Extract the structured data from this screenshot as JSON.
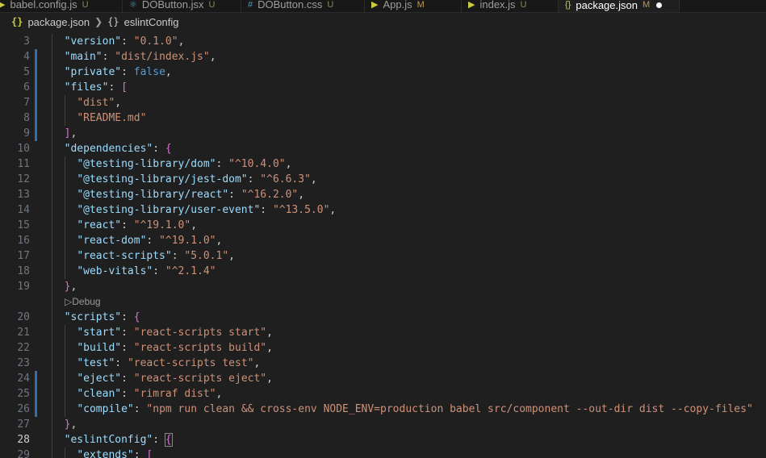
{
  "tabs": [
    {
      "label": "babel.config.js",
      "status": "U",
      "icon": "js-file-icon",
      "active": false
    },
    {
      "label": "DOButton.jsx",
      "status": "U",
      "icon": "react-file-icon",
      "active": false
    },
    {
      "label": "DOButton.css",
      "status": "U",
      "icon": "css-file-icon",
      "active": false
    },
    {
      "label": "App.js",
      "status": "M",
      "icon": "js-file-icon",
      "active": false
    },
    {
      "label": "index.js",
      "status": "U",
      "icon": "js-file-icon",
      "active": false
    },
    {
      "label": "package.json",
      "status": "M",
      "icon": "json-file-icon",
      "active": true
    }
  ],
  "breadcrumb": {
    "file_icon": "{}",
    "file": "package.json",
    "object_icon": "{}",
    "symbol": "eslintConfig"
  },
  "codelens": "Debug",
  "lines": [
    {
      "num": "3",
      "tokens": [
        [
          "p",
          "  "
        ],
        [
          "k",
          "\"version\""
        ],
        [
          "p",
          ": "
        ],
        [
          "s",
          "\"0.1.0\""
        ],
        [
          "p",
          ","
        ]
      ]
    },
    {
      "num": "4",
      "tokens": [
        [
          "p",
          "  "
        ],
        [
          "k",
          "\"main\""
        ],
        [
          "p",
          ": "
        ],
        [
          "s",
          "\"dist/index.js\""
        ],
        [
          "p",
          ","
        ]
      ]
    },
    {
      "num": "5",
      "tokens": [
        [
          "p",
          "  "
        ],
        [
          "k",
          "\"private\""
        ],
        [
          "p",
          ": "
        ],
        [
          "b",
          "false"
        ],
        [
          "p",
          ","
        ]
      ]
    },
    {
      "num": "6",
      "tokens": [
        [
          "p",
          "  "
        ],
        [
          "k",
          "\"files\""
        ],
        [
          "p",
          ": "
        ],
        [
          "br1",
          "["
        ]
      ]
    },
    {
      "num": "7",
      "tokens": [
        [
          "p",
          "    "
        ],
        [
          "s",
          "\"dist\""
        ],
        [
          "p",
          ","
        ]
      ]
    },
    {
      "num": "8",
      "tokens": [
        [
          "p",
          "    "
        ],
        [
          "s",
          "\"README.md\""
        ]
      ]
    },
    {
      "num": "9",
      "tokens": [
        [
          "p",
          "  "
        ],
        [
          "br1",
          "]"
        ],
        [
          "p",
          ","
        ]
      ]
    },
    {
      "num": "10",
      "tokens": [
        [
          "p",
          "  "
        ],
        [
          "k",
          "\"dependencies\""
        ],
        [
          "p",
          ": "
        ],
        [
          "br1",
          "{"
        ]
      ]
    },
    {
      "num": "11",
      "tokens": [
        [
          "p",
          "    "
        ],
        [
          "k",
          "\"@testing-library/dom\""
        ],
        [
          "p",
          ": "
        ],
        [
          "s",
          "\"^10.4.0\""
        ],
        [
          "p",
          ","
        ]
      ]
    },
    {
      "num": "12",
      "tokens": [
        [
          "p",
          "    "
        ],
        [
          "k",
          "\"@testing-library/jest-dom\""
        ],
        [
          "p",
          ": "
        ],
        [
          "s",
          "\"^6.6.3\""
        ],
        [
          "p",
          ","
        ]
      ]
    },
    {
      "num": "13",
      "tokens": [
        [
          "p",
          "    "
        ],
        [
          "k",
          "\"@testing-library/react\""
        ],
        [
          "p",
          ": "
        ],
        [
          "s",
          "\"^16.2.0\""
        ],
        [
          "p",
          ","
        ]
      ]
    },
    {
      "num": "14",
      "tokens": [
        [
          "p",
          "    "
        ],
        [
          "k",
          "\"@testing-library/user-event\""
        ],
        [
          "p",
          ": "
        ],
        [
          "s",
          "\"^13.5.0\""
        ],
        [
          "p",
          ","
        ]
      ]
    },
    {
      "num": "15",
      "tokens": [
        [
          "p",
          "    "
        ],
        [
          "k",
          "\"react\""
        ],
        [
          "p",
          ": "
        ],
        [
          "s",
          "\"^19.1.0\""
        ],
        [
          "p",
          ","
        ]
      ]
    },
    {
      "num": "16",
      "tokens": [
        [
          "p",
          "    "
        ],
        [
          "k",
          "\"react-dom\""
        ],
        [
          "p",
          ": "
        ],
        [
          "s",
          "\"^19.1.0\""
        ],
        [
          "p",
          ","
        ]
      ]
    },
    {
      "num": "17",
      "tokens": [
        [
          "p",
          "    "
        ],
        [
          "k",
          "\"react-scripts\""
        ],
        [
          "p",
          ": "
        ],
        [
          "s",
          "\"5.0.1\""
        ],
        [
          "p",
          ","
        ]
      ]
    },
    {
      "num": "18",
      "tokens": [
        [
          "p",
          "    "
        ],
        [
          "k",
          "\"web-vitals\""
        ],
        [
          "p",
          ": "
        ],
        [
          "s",
          "\"^2.1.4\""
        ]
      ]
    },
    {
      "num": "19",
      "tokens": [
        [
          "p",
          "  "
        ],
        [
          "br1",
          "}"
        ],
        [
          "p",
          ","
        ]
      ]
    },
    {
      "num": "",
      "lens": true
    },
    {
      "num": "20",
      "tokens": [
        [
          "p",
          "  "
        ],
        [
          "k",
          "\"scripts\""
        ],
        [
          "p",
          ": "
        ],
        [
          "br1",
          "{"
        ]
      ]
    },
    {
      "num": "21",
      "tokens": [
        [
          "p",
          "    "
        ],
        [
          "k",
          "\"start\""
        ],
        [
          "p",
          ": "
        ],
        [
          "s",
          "\"react-scripts start\""
        ],
        [
          "p",
          ","
        ]
      ]
    },
    {
      "num": "22",
      "tokens": [
        [
          "p",
          "    "
        ],
        [
          "k",
          "\"build\""
        ],
        [
          "p",
          ": "
        ],
        [
          "s",
          "\"react-scripts build\""
        ],
        [
          "p",
          ","
        ]
      ]
    },
    {
      "num": "23",
      "tokens": [
        [
          "p",
          "    "
        ],
        [
          "k",
          "\"test\""
        ],
        [
          "p",
          ": "
        ],
        [
          "s",
          "\"react-scripts test\""
        ],
        [
          "p",
          ","
        ]
      ]
    },
    {
      "num": "24",
      "tokens": [
        [
          "p",
          "    "
        ],
        [
          "k",
          "\"eject\""
        ],
        [
          "p",
          ": "
        ],
        [
          "s",
          "\"react-scripts eject\""
        ],
        [
          "p",
          ","
        ]
      ]
    },
    {
      "num": "25",
      "tokens": [
        [
          "p",
          "    "
        ],
        [
          "k",
          "\"clean\""
        ],
        [
          "p",
          ": "
        ],
        [
          "s",
          "\"rimraf dist\""
        ],
        [
          "p",
          ","
        ]
      ]
    },
    {
      "num": "26",
      "tokens": [
        [
          "p",
          "    "
        ],
        [
          "k",
          "\"compile\""
        ],
        [
          "p",
          ": "
        ],
        [
          "s",
          "\"npm run clean && cross-env NODE_ENV=production babel src/component --out-dir dist --copy-files\""
        ]
      ]
    },
    {
      "num": "27",
      "tokens": [
        [
          "p",
          "  "
        ],
        [
          "br1",
          "}"
        ],
        [
          "p",
          ","
        ]
      ]
    },
    {
      "num": "28",
      "current": true,
      "tokens": [
        [
          "p",
          "  "
        ],
        [
          "k",
          "\"eslintConfig\""
        ],
        [
          "p",
          ": "
        ],
        [
          "br1",
          "{"
        ]
      ]
    },
    {
      "num": "29",
      "tokens": [
        [
          "p",
          "    "
        ],
        [
          "k",
          "\"extends\""
        ],
        [
          "p",
          ": "
        ],
        [
          "br1",
          "["
        ]
      ]
    }
  ],
  "modified_lines": [
    "4",
    "5",
    "6",
    "7",
    "8",
    "9",
    "24",
    "25",
    "26"
  ],
  "colors": {
    "background": "#1f1f1f",
    "key": "#9cdcfe",
    "string": "#ce9178",
    "boolean": "#569cd6",
    "bracket": "#da70d6",
    "modified_marker": "#2f6fb3"
  }
}
